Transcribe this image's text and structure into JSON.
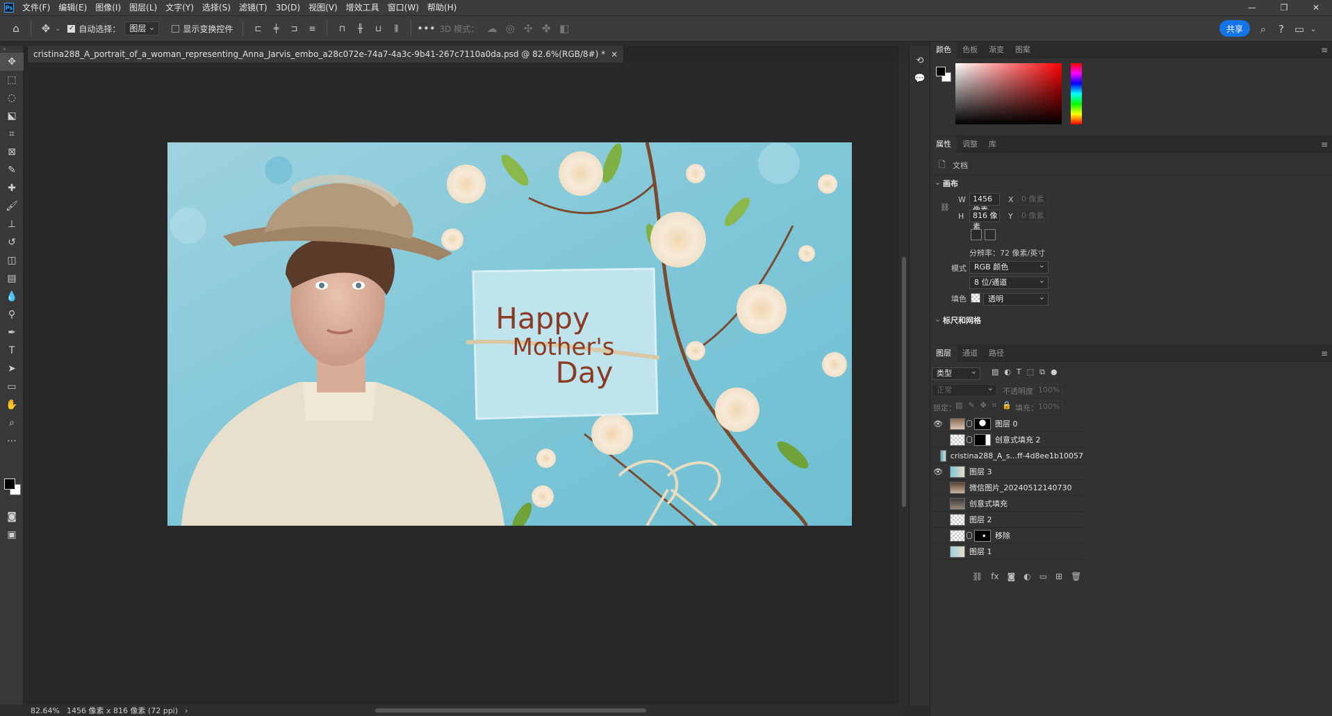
{
  "app": {
    "logo_text": "Ps"
  },
  "menu": [
    "文件(F)",
    "编辑(E)",
    "图像(I)",
    "图层(L)",
    "文字(Y)",
    "选择(S)",
    "滤镜(T)",
    "3D(D)",
    "视图(V)",
    "增效工具",
    "窗口(W)",
    "帮助(H)"
  ],
  "window": {
    "minimize": "—",
    "restore": "❐",
    "close": "✕"
  },
  "options": {
    "auto_select_label": "自动选择：",
    "auto_select_value": "图层",
    "show_transform_label": "显示变换控件",
    "mode_3d_label": "3D 模式：",
    "share_label": "共享",
    "more": "•••"
  },
  "document": {
    "tab_title": "cristina288_A_portrait_of_a_woman_representing_Anna_Jarvis_embo_a28c072e-74a7-4a3c-9b41-267c7110a0da.psd @ 82.6%(RGB/8#) *",
    "tab_close": "×",
    "zoom": "82.64%",
    "size_info": "1456 像素 x 816 像素 (72 ppi)",
    "status_arrow": "›",
    "card_text": [
      "Happy",
      "Mother's",
      "Day"
    ]
  },
  "color_panel": {
    "tabs": [
      "颜色",
      "色板",
      "渐变",
      "图案"
    ],
    "accent": "#ff0000"
  },
  "properties_panel": {
    "tabs": [
      "属性",
      "调整",
      "库"
    ],
    "doc_label": "文档",
    "canvas_section": "画布",
    "w_label": "W",
    "w_value": "1456 像素",
    "h_label": "H",
    "h_value": "816 像素",
    "x_label": "X",
    "x_placeholder": "0 像素",
    "y_label": "Y",
    "y_placeholder": "0 像素",
    "resolution": "分辨率：72 像素/英寸",
    "mode_label": "模式",
    "mode_value": "RGB 颜色",
    "depth_value": "8 位/通道",
    "fill_label": "填色",
    "fill_value": "透明",
    "rulers_section": "标尺和网格"
  },
  "layers_panel": {
    "tabs": [
      "图层",
      "通道",
      "路径"
    ],
    "filter_type": "类型",
    "blend_mode": "正常",
    "opacity_label": "不透明度：",
    "opacity_value": "100%",
    "lock_label": "锁定：",
    "fill_label": "填充：",
    "fill_value": "100%",
    "layers": [
      {
        "name": "图层 0",
        "visible": true
      },
      {
        "name": "创意式填充 2",
        "visible": false
      },
      {
        "name": "cristina288_A_s...ff-4d8ee1b10057",
        "visible": false
      },
      {
        "name": "图层 3",
        "visible": true
      },
      {
        "name": "微信图片_20240512140730",
        "visible": false
      },
      {
        "name": "创意式填充",
        "visible": false
      },
      {
        "name": "图层 2",
        "visible": false
      },
      {
        "name": "移除",
        "visible": false
      },
      {
        "name": "图层 1",
        "visible": false
      }
    ]
  }
}
